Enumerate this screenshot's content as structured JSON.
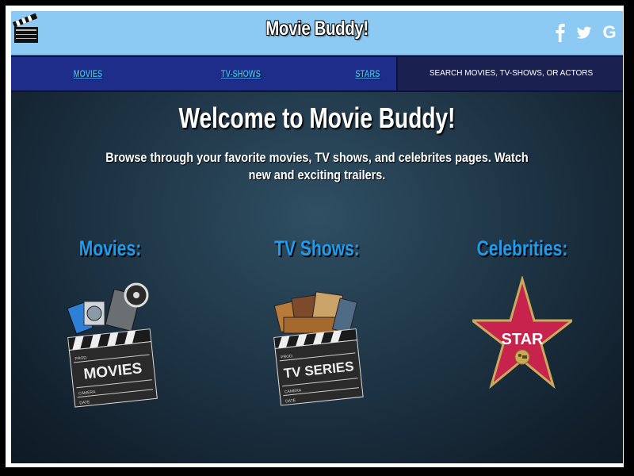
{
  "header": {
    "brand": "Movie Buddy!",
    "social": [
      {
        "icon": "facebook-icon",
        "glyph": "f"
      },
      {
        "icon": "twitter-icon",
        "glyph": "t"
      },
      {
        "icon": "google-icon",
        "glyph": "G"
      }
    ]
  },
  "nav": {
    "items": [
      "MOVIES",
      "TV-SHOWS",
      "STARS"
    ],
    "search_label": "SEARCH MOVIES, TV-SHOWS, OR ACTORS"
  },
  "main": {
    "title": "Welcome to Movie Buddy!",
    "description": "Browse through your favorite movies, TV shows, and celebrites pages. Watch new and exciting trailers.",
    "categories": [
      {
        "title": "Movies:",
        "image_text": "MOVIES"
      },
      {
        "title": "TV Shows:",
        "image_text": "TV SERIES"
      },
      {
        "title": "Celebrities:",
        "image_text": "STAR"
      }
    ],
    "clapper_labels": {
      "prod": "PROD.",
      "camera": "CAMERA",
      "date": "DATE"
    }
  },
  "colors": {
    "header_bg": "#8ccaf3",
    "nav_bg": "#1e2d8a",
    "nav_link": "#37b7ff",
    "category_title": "#1e9cf0",
    "star": "#c8234d"
  }
}
